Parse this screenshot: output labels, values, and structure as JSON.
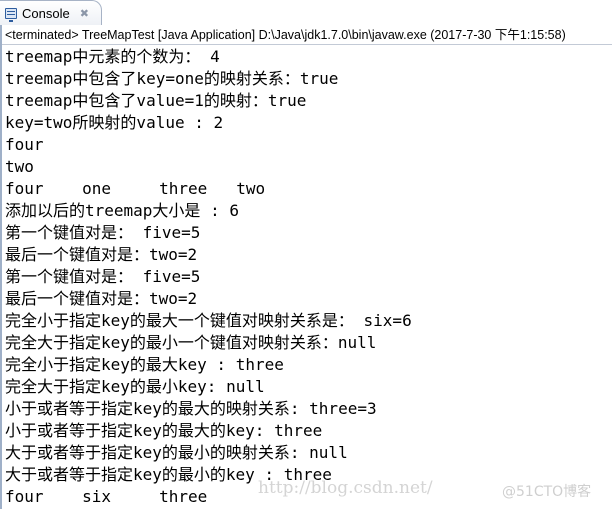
{
  "tab": {
    "icon": "console-icon",
    "label": "Console",
    "close_glyph": "✖"
  },
  "status": "<terminated> TreeMapTest [Java Application] D:\\Java\\jdk1.7.0\\bin\\javaw.exe (2017-7-30 下午1:15:58)",
  "output_lines": [
    "treemap中元素的个数为： 4",
    "treemap中包含了key=one的映射关系：true",
    "treemap中包含了value=1的映射：true",
    "key=two所映射的value : 2",
    "four",
    "two",
    "four    one     three   two",
    "添加以后的treemap大小是 : 6",
    "第一个键值对是： five=5",
    "最后一个键值对是：two=2",
    "第一个键值对是： five=5",
    "最后一个键值对是：two=2",
    "完全小于指定key的最大一个键值对映射关系是： six=6",
    "完全大于指定key的最小一个键值对映射关系：null",
    "完全小于指定key的最大key : three",
    "完全大于指定key的最小key: null",
    "小于或者等于指定key的最大的映射关系: three=3",
    "小于或者等于指定key的最大的key: three",
    "大于或者等于指定key的最小的映射关系: null",
    "大于或者等于指定key的最小的key : three",
    "four    six     three"
  ],
  "watermark": {
    "url": "http://blog.csdn.net/",
    "brand": "@51CTO博客"
  }
}
